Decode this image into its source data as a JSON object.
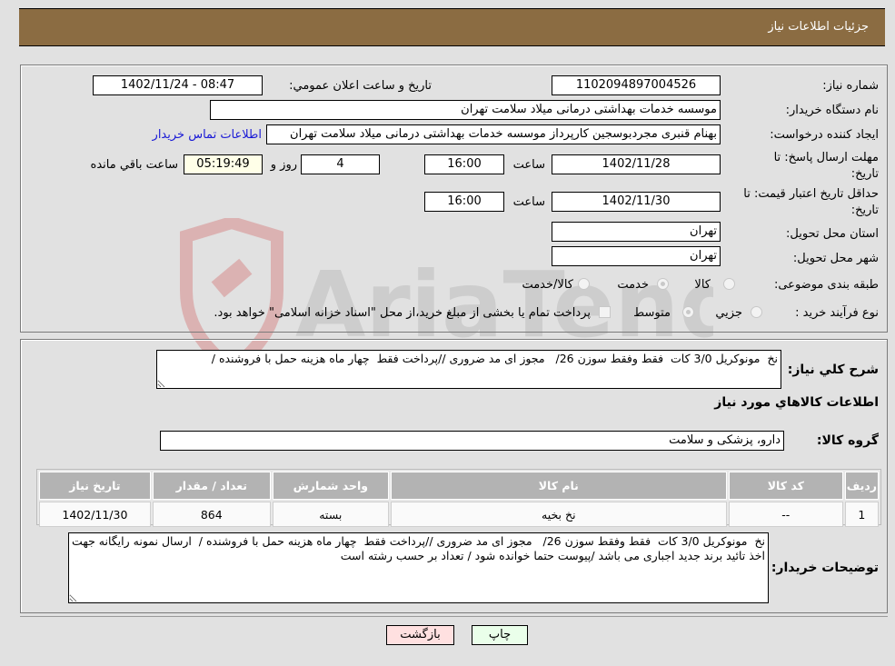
{
  "header": {
    "title": "جزئیات اطلاعات نیاز"
  },
  "form": {
    "need_number": {
      "label": "شماره نیاز:",
      "value": "1102094897004526"
    },
    "announce_datetime": {
      "label": "تاریخ و ساعت اعلان عمومي:",
      "value": "1402/11/24 - 08:47"
    },
    "buyer_org": {
      "label": "نام دستگاه خريدار:",
      "value": "موسسه خدمات بهداشتی درمانی میلاد سلامت تهران"
    },
    "creator": {
      "label": "ایجاد کننده درخواست:",
      "value": "بهنام قنبری مجردبوسجین کارپرداز موسسه خدمات بهداشتی درمانی میلاد سلامت تهران",
      "contact_link": "اطلاعات تماس خریدار"
    },
    "response_deadline": {
      "label_line1": "مهلت ارسال پاسخ: تا",
      "label_line2": "تاریخ:",
      "date": "1402/11/28",
      "time_label": "ساعت",
      "time": "16:00",
      "days": "4",
      "days_label": "روز و",
      "remaining": "05:19:49",
      "remaining_label": "ساعت باقي مانده"
    },
    "price_validity": {
      "label_line1": "حداقل تاریخ اعتبار قیمت: تا",
      "label_line2": "تاریخ:",
      "date": "1402/11/30",
      "time_label": "ساعت",
      "time": "16:00"
    },
    "province": {
      "label": "استان محل تحویل:",
      "value": "تهران"
    },
    "city": {
      "label": "شهر محل تحویل:",
      "value": "تهران"
    },
    "category": {
      "label": "طبقه بندی موضوعی:",
      "options": [
        "کالا",
        "خدمت",
        "کالا/خدمت"
      ],
      "selected": "خدمت"
    },
    "purchase_type": {
      "label": "نوع فرآیند خرید :",
      "options": [
        "جزيي",
        "متوسط"
      ],
      "selected": "متوسط",
      "treasury_note": "پرداخت تمام یا بخشی از مبلغ خرید،از محل \"اسناد خزانه اسلامی\" خواهد بود."
    }
  },
  "description": {
    "label": "شرح كلي نياز:",
    "value": "نخ  مونوکریل 3/0 کات  فقط وفقط سوزن 26/   مجوز ای مد ضروری //پرداخت فقط  چهار ماه هزینه حمل با فروشنده /"
  },
  "goods": {
    "section_title": "اطلاعات كالاهاي مورد نياز",
    "group_label": "گروه کالا:",
    "group_value": "دارو، پزشکی و سلامت",
    "table": {
      "headers": [
        "رديف",
        "کد کالا",
        "نام کالا",
        "واحد شمارش",
        "تعداد / مقدار",
        "تاریخ نیاز"
      ],
      "rows": [
        [
          "1",
          "--",
          "نخ بخیه",
          "بسته",
          "864",
          "1402/11/30"
        ]
      ]
    }
  },
  "buyer_notes": {
    "label": "توضيحات خريدار:",
    "value": "نخ  مونوکریل 3/0 کات  فقط وفقط سوزن 26/   مجوز ای مد ضروری //پرداخت فقط  چهار ماه هزینه حمل با فروشنده /  ارسال نمونه رایگانه جهت اخذ تائید برند جدید اجباری می باشد /پیوست حتما خوانده شود / تعداد بر حسب رشته است"
  },
  "buttons": {
    "print": "چاپ",
    "back": "بازگشت"
  },
  "watermark": {
    "text": "AriaTender.neT"
  },
  "colors": {
    "header_bg": "#8b6c42",
    "print_bg": "#eaffea",
    "back_bg": "#ffe0e0",
    "link": "#1a1ad6"
  }
}
